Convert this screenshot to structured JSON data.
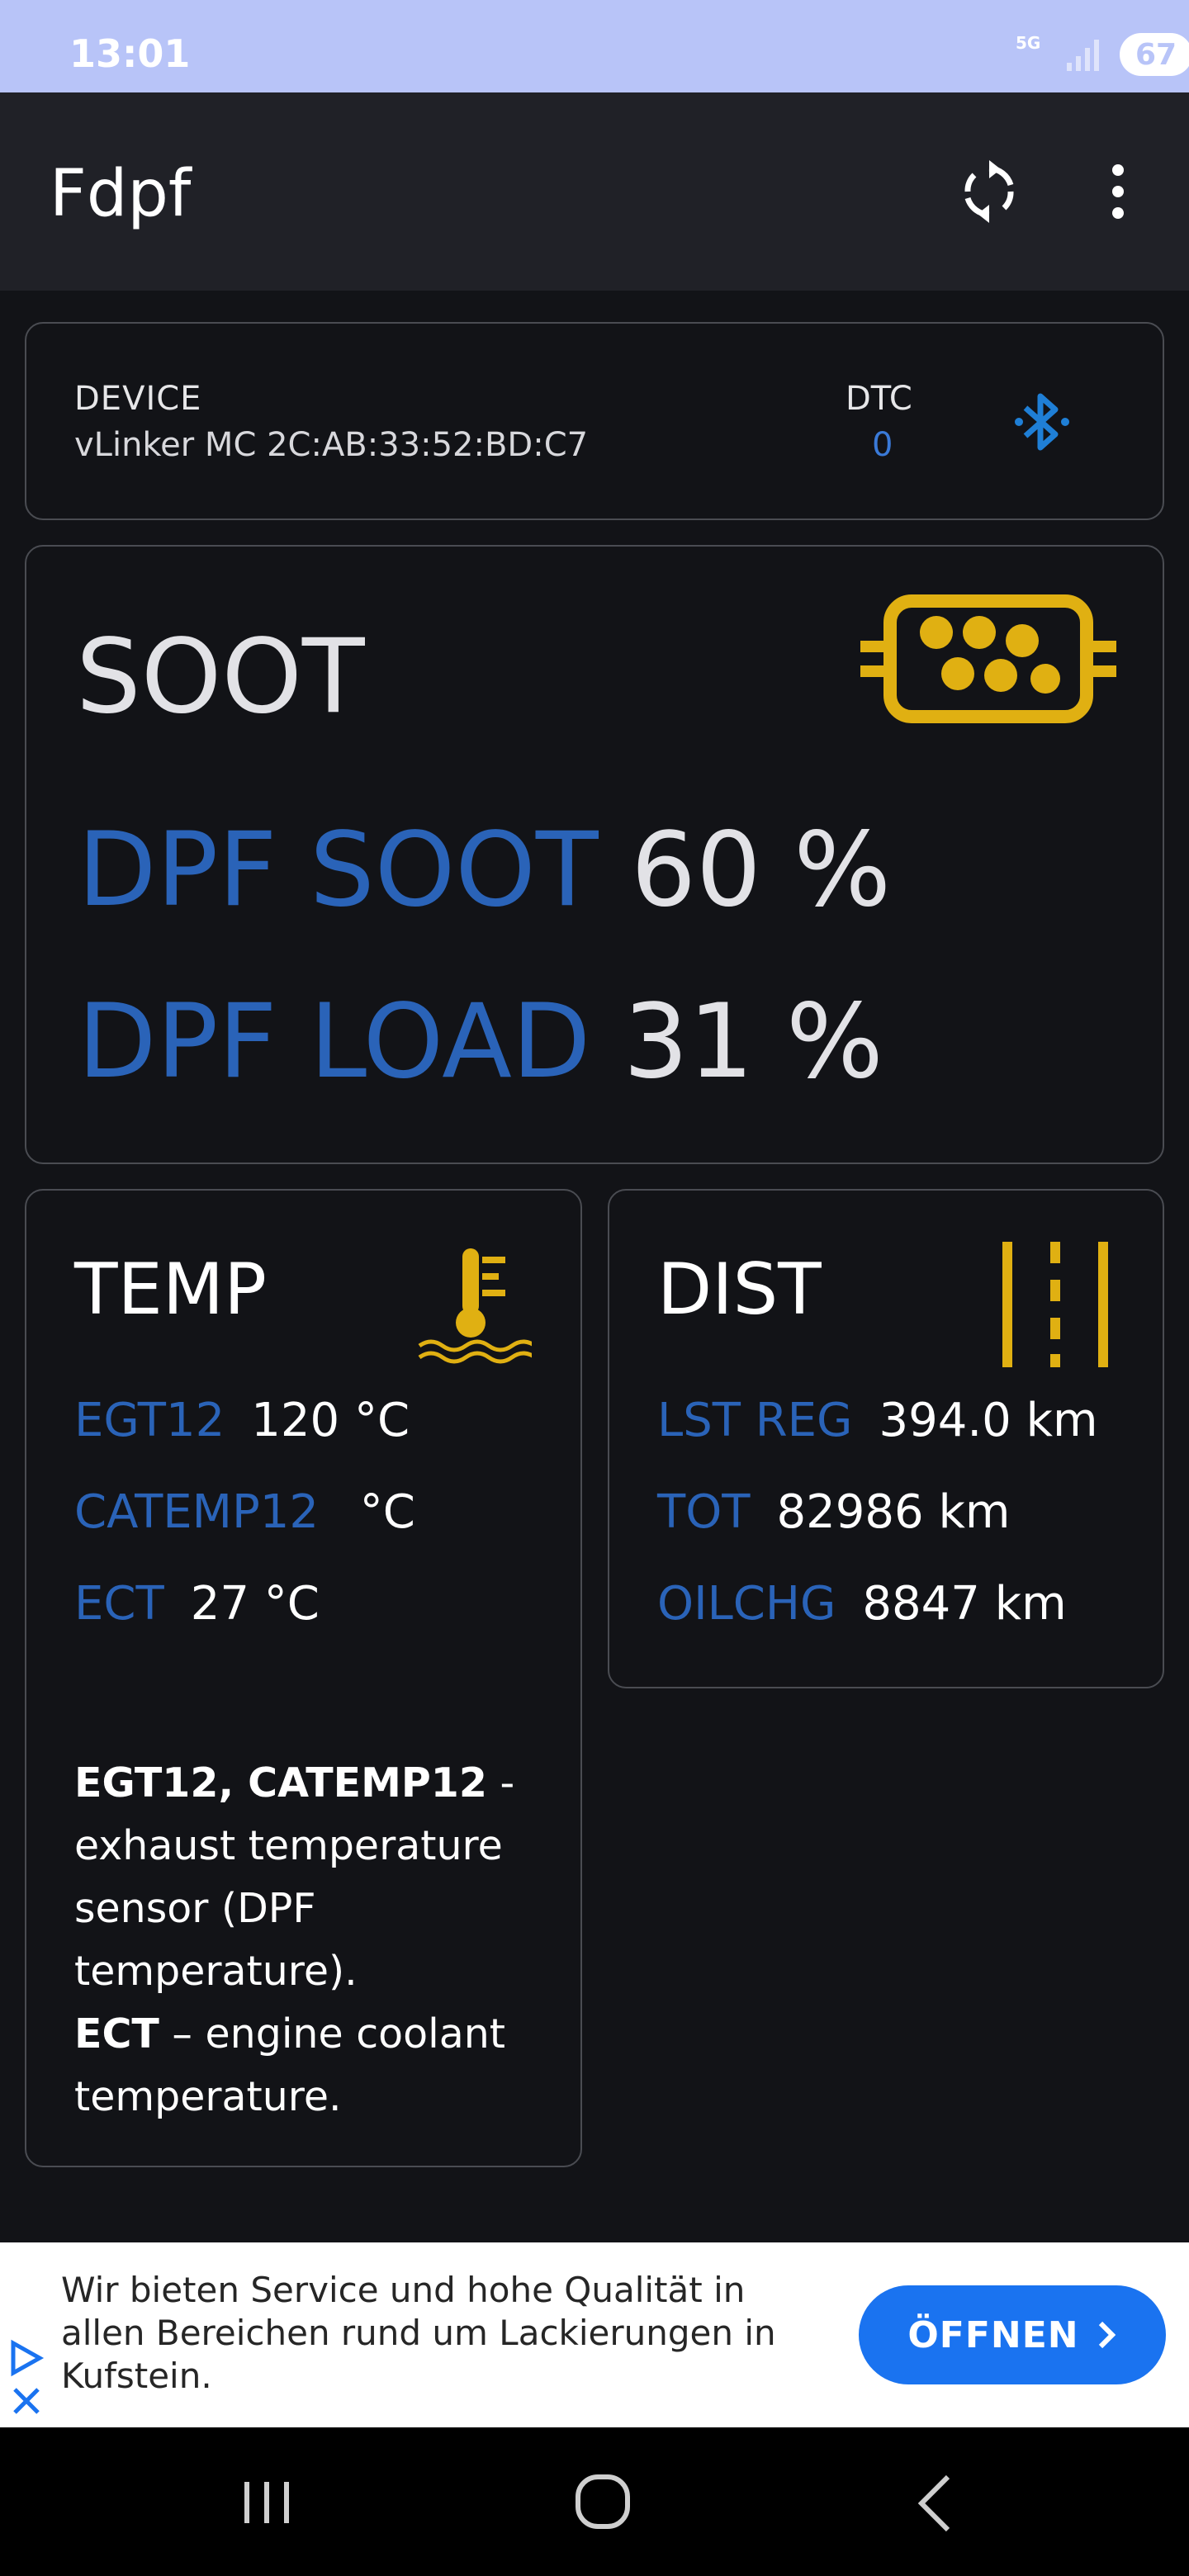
{
  "status_bar": {
    "time": "13:01",
    "network": "5G",
    "battery": "67"
  },
  "app_bar": {
    "title": "Fdpf",
    "icons": [
      "sync-icon",
      "more-vert-icon"
    ]
  },
  "device": {
    "label": "DEVICE",
    "value": "vLinker MC 2C:AB:33:52:BD:C7",
    "dtc_label": "DTC",
    "dtc_value": "0",
    "icon": "bluetooth-icon"
  },
  "soot": {
    "title": "SOOT",
    "icon": "dpf-filter-icon",
    "dpf_soot": {
      "label": "DPF SOOT",
      "value": "60",
      "unit": "%"
    },
    "dpf_load": {
      "label": "DPF LOAD",
      "value": "31",
      "unit": "%"
    }
  },
  "temp": {
    "title": "TEMP",
    "icon": "coolant-thermometer-icon",
    "rows": [
      {
        "key": "EGT12",
        "value": "120 °C"
      },
      {
        "key": "CATEMP12",
        "value": " °C"
      },
      {
        "key": "ECT",
        "value": "27 °C"
      }
    ],
    "note": {
      "bold1": "EGT12, CATEMP12",
      "text1": " - exhaust temperature sensor (DPF temperature).",
      "bold2": "ECT",
      "text2": " – engine coolant temperature."
    }
  },
  "dist": {
    "title": "DIST",
    "icon": "road-icon",
    "rows": [
      {
        "key": "LST REG",
        "value": "394.0 km"
      },
      {
        "key": "TOT",
        "value": "82986 km"
      },
      {
        "key": "OILCHG",
        "value": "8847 km"
      }
    ]
  },
  "ad": {
    "text": "Wir bieten Service und hohe Qualität in allen Bereichen rund um Lackierungen in Kufstein.",
    "button": "ÖFFNEN"
  },
  "colors": {
    "accent_blue": "#2a63b8",
    "icon_yellow": "#e0b012",
    "bluetooth_blue": "#1f7fd6",
    "status_bar": "#b8c4f8",
    "ad_button": "#1a73f0"
  }
}
